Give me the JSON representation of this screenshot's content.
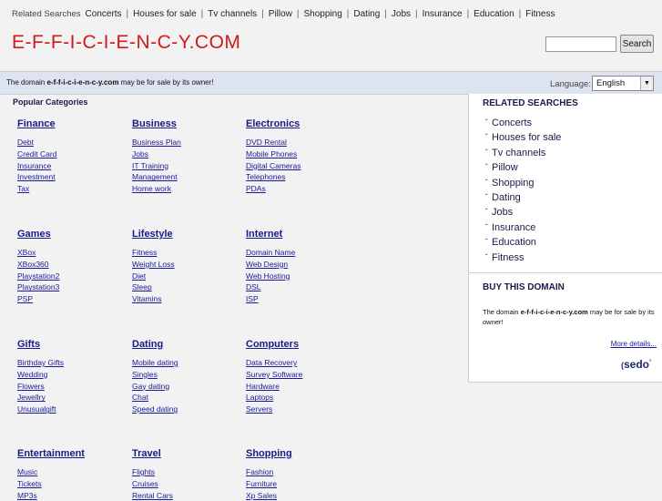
{
  "header": {
    "related_label": "Related Searches",
    "related_links": [
      "Concerts",
      "Houses for sale",
      "Tv channels",
      "Pillow",
      "Shopping",
      "Dating",
      "Jobs",
      "Insurance",
      "Education",
      "Fitness"
    ],
    "site_title": "E-F-F-I-C-I-E-N-C-Y.COM",
    "search_placeholder": "",
    "search_button": "Search"
  },
  "sale_bar": {
    "text_before": "The domain ",
    "domain": "e-f-f-i-c-i-e-n-c-y.com",
    "text_after": " may be for sale by its owner!",
    "language_label": "Language:",
    "language_value": "English"
  },
  "main": {
    "popular_title": "Popular Categories",
    "categories": [
      {
        "name": "Finance",
        "items": [
          "Debt",
          "Credit Card",
          "Insurance",
          "Investment",
          "Tax"
        ]
      },
      {
        "name": "Business",
        "items": [
          "Business Plan",
          "Jobs",
          "IT Training",
          "Management",
          "Home work"
        ]
      },
      {
        "name": "Electronics",
        "items": [
          "DVD Rental",
          "Mobile Phones",
          "Digital Cameras",
          "Telephones",
          "PDAs"
        ]
      },
      {
        "name": "Games",
        "items": [
          "XBox",
          "XBox360",
          "Playstation2",
          "Playstation3",
          "PSP"
        ]
      },
      {
        "name": "Lifestyle",
        "items": [
          "Fitness",
          "Weight Loss",
          "Diet",
          "Sleep",
          "Vitamins"
        ]
      },
      {
        "name": "Internet",
        "items": [
          "Domain Name",
          "Web Design",
          "Web Hosting",
          "DSL",
          "ISP"
        ]
      },
      {
        "name": "Gifts",
        "items": [
          "Birthday Gifts",
          "Wedding",
          "Flowers",
          "Jewellry",
          "Unusualgift"
        ]
      },
      {
        "name": "Dating",
        "items": [
          "Mobile dating",
          "Singles",
          "Gay dating",
          "Chat",
          "Speed dating"
        ]
      },
      {
        "name": "Computers",
        "items": [
          "Data Recovery",
          "Survey Software",
          "Hardware",
          "Laptops",
          "Servers"
        ]
      },
      {
        "name": "Entertainment",
        "items": [
          "Music",
          "Tickets",
          "MP3s"
        ]
      },
      {
        "name": "Travel",
        "items": [
          "Flights",
          "Cruises",
          "Rental Cars"
        ]
      },
      {
        "name": "Shopping",
        "items": [
          "Fashion",
          "Furniture",
          "Xp Sales"
        ]
      }
    ]
  },
  "sidebar": {
    "related_title": "RELATED SEARCHES",
    "related_items": [
      "Concerts",
      "Houses for sale",
      "Tv channels",
      "Pillow",
      "Shopping",
      "Dating",
      "Jobs",
      "Insurance",
      "Education",
      "Fitness"
    ],
    "buy_title": "BUY THIS DOMAIN",
    "buy_text_before": "The domain ",
    "buy_domain": "e-f-f-i-c-i-e-n-c-y.com",
    "buy_text_after": " may be for sale by its owner!",
    "more_details": "More details...",
    "logo_text": "sedo"
  }
}
